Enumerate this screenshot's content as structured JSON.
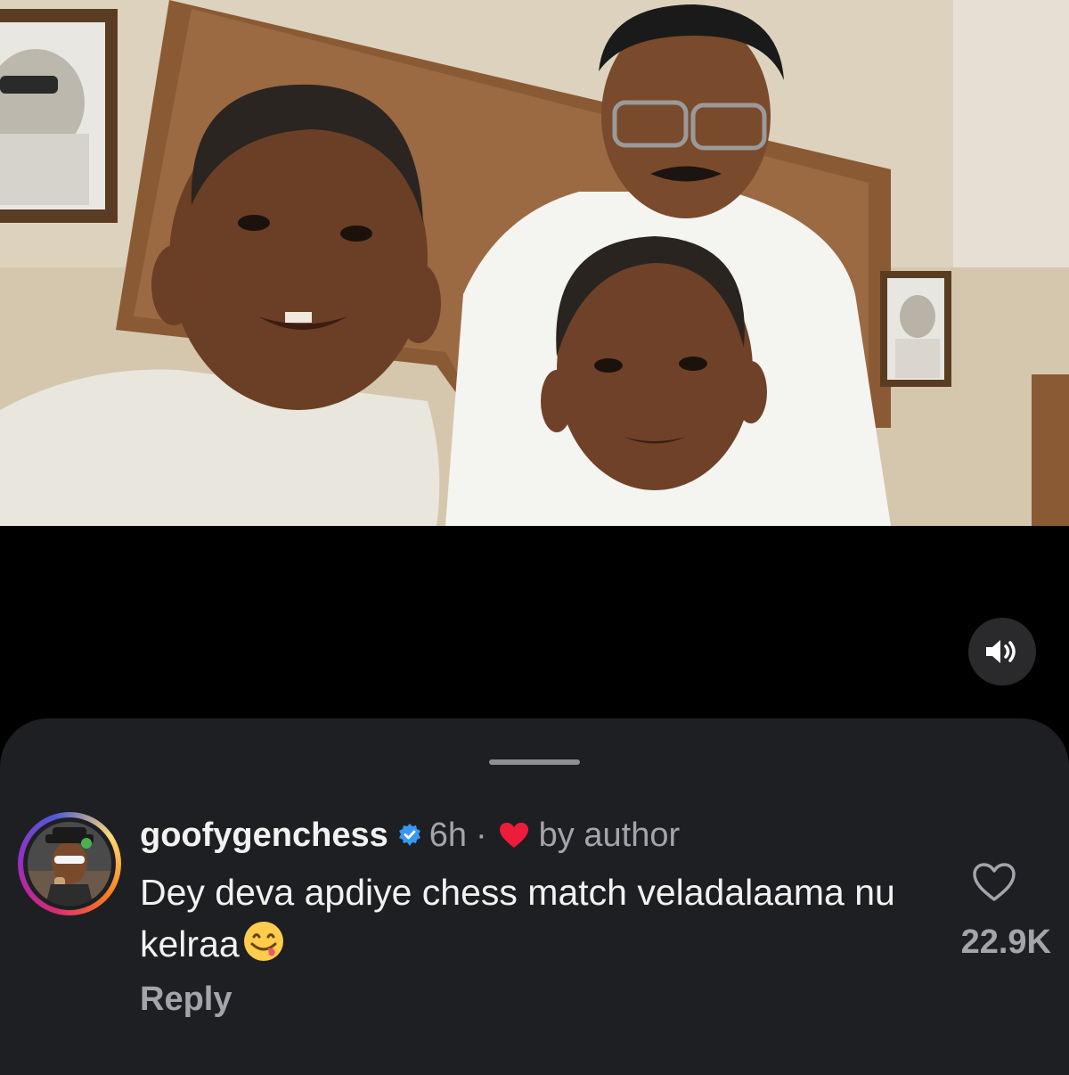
{
  "video": {
    "sound_icon": "speaker-volume-icon"
  },
  "comment": {
    "username": "goofygenchess",
    "verified_icon": "verified-badge-icon",
    "time": "6h",
    "separator": "·",
    "liked_by_author_icon": "heart-filled-icon",
    "by_author": "by author",
    "text": "Dey deva apdiye chess match veladalaama nu kelraa",
    "emoji_icon": "face-savoring-food-emoji",
    "reply_label": "Reply",
    "like_icon": "heart-outline-icon",
    "like_count": "22.9K"
  },
  "colors": {
    "sheet_bg": "#1e1f22",
    "primary_text": "#f2f2f2",
    "secondary_text": "#a3a5ab",
    "verified_blue": "#3897f0",
    "heart_red": "#ed1c3a"
  }
}
